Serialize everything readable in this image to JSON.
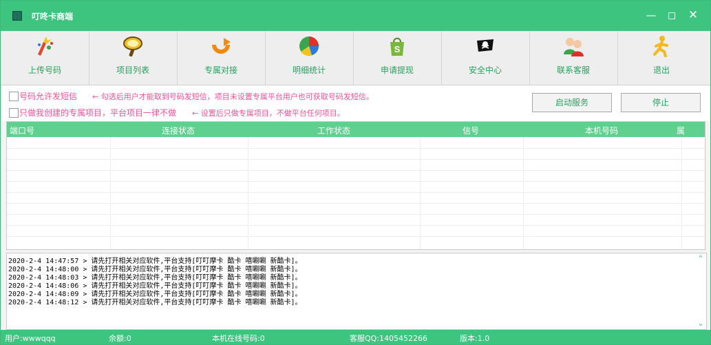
{
  "window": {
    "title": "叮咚卡商端",
    "accent": "#3dc47e"
  },
  "toolbar": {
    "items": [
      {
        "label": "上传号码",
        "icon": "upload-sparkle-icon"
      },
      {
        "label": "项目列表",
        "icon": "magnifier-icon"
      },
      {
        "label": "专属对接",
        "icon": "refresh-arrow-icon"
      },
      {
        "label": "明细统计",
        "icon": "pie-chart-icon"
      },
      {
        "label": "申请提现",
        "icon": "shopping-bag-icon"
      },
      {
        "label": "安全中心",
        "icon": "pirate-flag-icon"
      },
      {
        "label": "联系客服",
        "icon": "contacts-icon"
      },
      {
        "label": "退出",
        "icon": "running-man-icon"
      }
    ]
  },
  "options": {
    "allow_sms_label": "号码允许发短信",
    "allow_sms_hint": "← 勾选后用户才能取到号码发短信，项目未设置专属平台用户也可获取号码发短信。",
    "only_exclusive_label": "只做我创建的专属项目，平台项目一律不做",
    "only_exclusive_hint": "← 设置后只做专属项目，不做平台任何项目。",
    "start_label": "启动服务",
    "stop_label": "停止"
  },
  "grid": {
    "columns": [
      "端口号",
      "连接状态",
      "工作状态",
      "信号",
      "本机号码",
      "属"
    ]
  },
  "log": {
    "lines": [
      "2020-2-4 14:47:57 > 请先打开相关对应软件,平台支持[叮叮摩卡 酷卡 嘻唰唰 新酷卡]。",
      "2020-2-4 14:48:00 > 请先打开相关对应软件,平台支持[叮叮摩卡 酷卡 嘻唰唰 新酷卡]。",
      "2020-2-4 14:48:03 > 请先打开相关对应软件,平台支持[叮叮摩卡 酷卡 嘻唰唰 新酷卡]。",
      "2020-2-4 14:48:06 > 请先打开相关对应软件,平台支持[叮叮摩卡 酷卡 嘻唰唰 新酷卡]。",
      "2020-2-4 14:48:09 > 请先打开相关对应软件,平台支持[叮叮摩卡 酷卡 嘻唰唰 新酷卡]。",
      "2020-2-4 14:48:12 > 请先打开相关对应软件,平台支持[叮叮摩卡 酷卡 嘻唰唰 新酷卡]。"
    ]
  },
  "status": {
    "user": "用户:wwwqqq",
    "balance": "余额:0",
    "online": "本机在线号码:0",
    "support": "客服QQ:1405452266",
    "version": "版本:1.0"
  }
}
